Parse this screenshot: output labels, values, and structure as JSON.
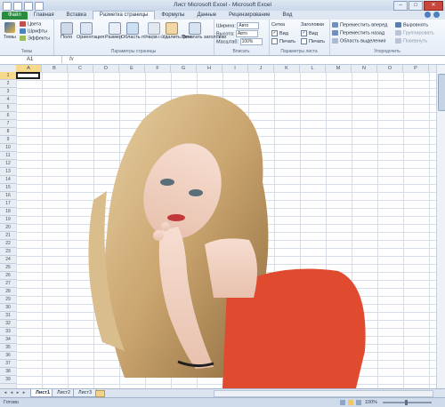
{
  "window": {
    "title": "Лист Microsoft Excel - Microsoft Excel"
  },
  "tabs": [
    "Файл",
    "Главная",
    "Вставка",
    "Разметка страницы",
    "Формулы",
    "Данные",
    "Рецензирование",
    "Вид"
  ],
  "ribbon": {
    "themes": {
      "label": "Темы",
      "themes_btn": "Темы",
      "colors": "Цвета",
      "fonts": "Шрифты",
      "effects": "Эффекты"
    },
    "page_setup": {
      "label": "Параметры страницы",
      "margins": "Поля",
      "orientation": "Ориентация",
      "size": "Размер",
      "print_area": "Область печати",
      "breaks": "Разрывы",
      "background": "Удалить фон",
      "print_titles": "Печатать заголовки"
    },
    "scale": {
      "label": "Вписать",
      "width": "Ширина:",
      "width_val": "Авто",
      "height": "Высота:",
      "height_val": "Авто",
      "scale": "Масштаб:",
      "scale_val": "100%"
    },
    "sheet_options": {
      "label": "Параметры листа",
      "gridlines": "Сетка",
      "headings": "Заголовки",
      "view": "Вид",
      "print": "Печать"
    },
    "arrange": {
      "label": "Упорядочить",
      "bring_forward": "Переместить вперед",
      "send_backward": "Переместить назад",
      "selection_pane": "Область выделения",
      "align": "Выровнять",
      "group": "Группировать",
      "rotate": "Повернуть"
    }
  },
  "formula_bar": {
    "name_box": "A1",
    "fx": "fx"
  },
  "columns": [
    "A",
    "B",
    "C",
    "D",
    "E",
    "F",
    "G",
    "H",
    "I",
    "J",
    "K",
    "L",
    "M",
    "N",
    "O",
    "P"
  ],
  "rows": [
    "1",
    "2",
    "3",
    "4",
    "5",
    "6",
    "7",
    "8",
    "9",
    "10",
    "11",
    "12",
    "13",
    "14",
    "15",
    "16",
    "17",
    "18",
    "19",
    "20",
    "21",
    "22",
    "23",
    "24",
    "25",
    "26",
    "27",
    "28",
    "29",
    "30",
    "31",
    "32",
    "33",
    "34",
    "35",
    "36",
    "37",
    "38",
    "39"
  ],
  "sheets": [
    "Лист1",
    "Лист2",
    "Лист3"
  ],
  "status": {
    "ready": "Готово",
    "zoom": "100%"
  },
  "colors": {
    "file_tab": "#2b8a3e",
    "selection": "#f8d98a",
    "photo_top": "#e8e4dc",
    "photo_shirt": "#e04b2f"
  }
}
